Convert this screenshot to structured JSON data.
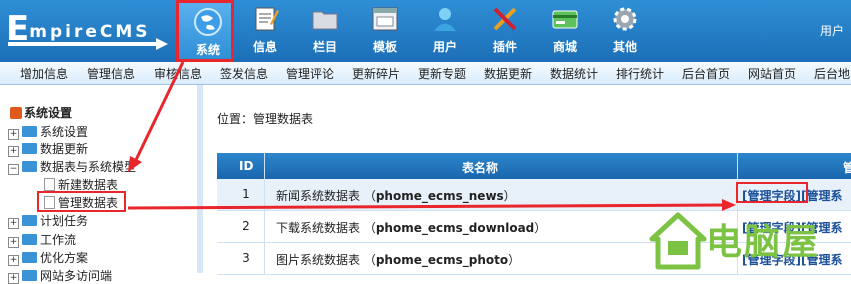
{
  "header": {
    "logo_big": "E",
    "logo_rest": "mpireCMS",
    "user_label": "用户",
    "nav": [
      {
        "label": "系统",
        "icon": "globe-icon",
        "active": true
      },
      {
        "label": "信息",
        "icon": "notepad-icon"
      },
      {
        "label": "栏目",
        "icon": "folder-icon"
      },
      {
        "label": "模板",
        "icon": "window-icon"
      },
      {
        "label": "用户",
        "icon": "user-icon"
      },
      {
        "label": "插件",
        "icon": "tools-icon"
      },
      {
        "label": "商城",
        "icon": "card-icon"
      },
      {
        "label": "其他",
        "icon": "gear-icon"
      }
    ]
  },
  "submenu": [
    "增加信息",
    "管理信息",
    "审核信息",
    "签发信息",
    "管理评论",
    "更新碎片",
    "更新专题",
    "数据更新",
    "数据统计",
    "排行统计",
    "后台首页",
    "网站首页",
    "后台地"
  ],
  "tree": {
    "title": "系统设置",
    "items": [
      {
        "label": "系统设置",
        "type": "folder",
        "toggle": "+"
      },
      {
        "label": "数据更新",
        "type": "folder",
        "toggle": "+"
      },
      {
        "label": "数据表与系统模型",
        "type": "folder",
        "toggle": "−"
      },
      {
        "label": "新建数据表",
        "type": "page"
      },
      {
        "label": "管理数据表",
        "type": "page"
      },
      {
        "label": "计划任务",
        "type": "folder",
        "toggle": "+"
      },
      {
        "label": "工作流",
        "type": "folder",
        "toggle": "+"
      },
      {
        "label": "优化方案",
        "type": "folder",
        "toggle": "+"
      },
      {
        "label": "网站多访问端",
        "type": "folder",
        "toggle": "+"
      }
    ]
  },
  "content": {
    "location_label": "位置：",
    "location_value": "管理数据表",
    "table": {
      "headers": {
        "id": "ID",
        "name": "表名称",
        "op": "管"
      },
      "rows": [
        {
          "id": "1",
          "name": "新闻系统数据表",
          "table": "phome_ecms_news",
          "action": "[管理字段]",
          "action2": "[管理系"
        },
        {
          "id": "2",
          "name": "下载系统数据表",
          "table": "phome_ecms_download",
          "action": "[管理字段]",
          "action2": "[管理系"
        },
        {
          "id": "3",
          "name": "图片系统数据表",
          "table": "phome_ecms_photo",
          "action": "[管理字段]",
          "action2": "[管理系"
        }
      ]
    }
  },
  "watermark": {
    "text": "电脑屋",
    "icon": "house-logo-icon",
    "color": "#7cc243"
  },
  "colors": {
    "header": "#1c6fb7",
    "highlight": "#e8262b",
    "link": "#1a4f9a"
  }
}
